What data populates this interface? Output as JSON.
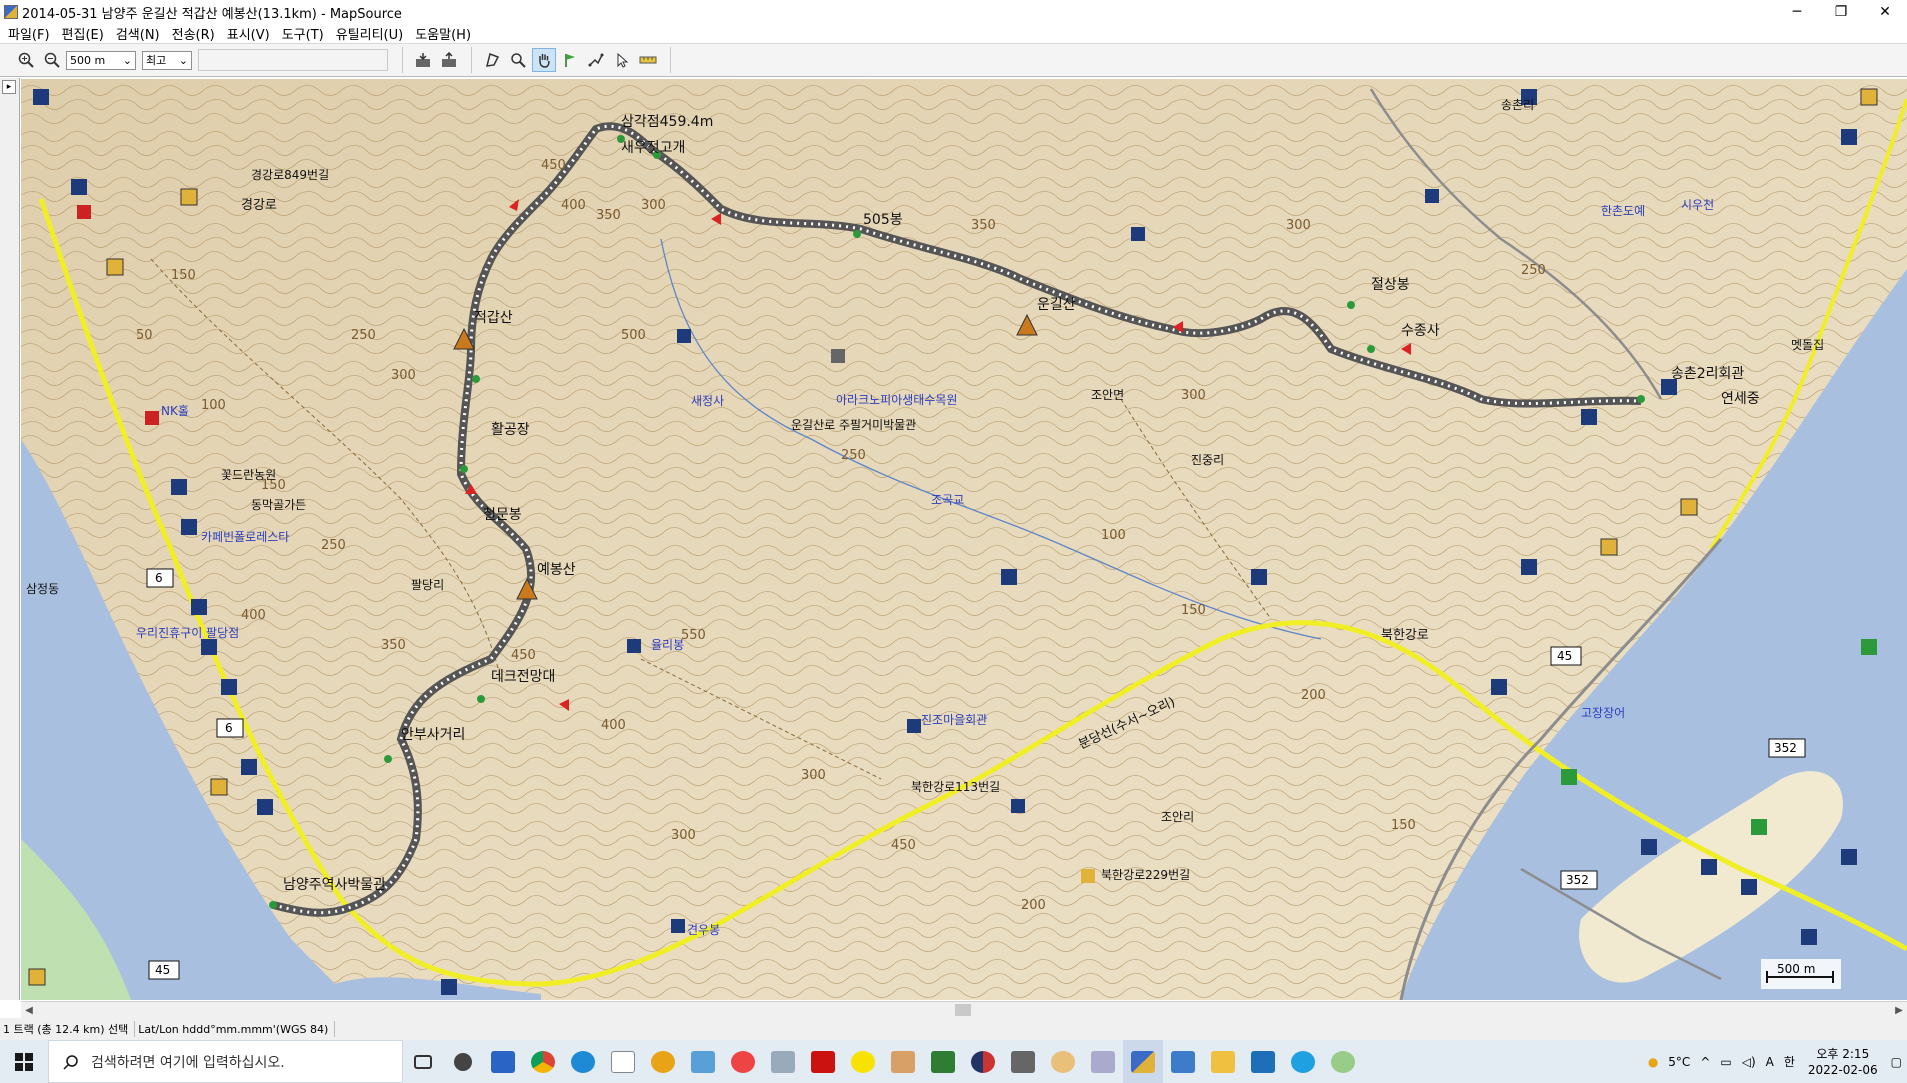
{
  "window": {
    "title": "2014-05-31 남양주 운길산 적갑산 예봉산(13.1km) - MapSource",
    "minimize": "─",
    "restore": "❐",
    "close": "✕"
  },
  "menu": [
    "파일(F)",
    "편집(E)",
    "검색(N)",
    "전송(R)",
    "표시(V)",
    "도구(T)",
    "유틸리티(U)",
    "도움말(H)"
  ],
  "toolbar": {
    "zoom_value": "500 m",
    "detail_value": "최고"
  },
  "map": {
    "colors": {
      "terrain": "#e9dcc0",
      "contour": "#b89a6a",
      "water": "#a9bfe0",
      "road_yellow": "#f0ee25",
      "track": "#6e6e6e",
      "label_blue": "#2b3ec0"
    },
    "peaks": [
      {
        "name": "적갑산"
      },
      {
        "name": "예봉산"
      },
      {
        "name": "운길산"
      }
    ],
    "waypoints": [
      {
        "name": "삼각점459.4m"
      },
      {
        "name": "새우젓고개"
      },
      {
        "name": "505봉"
      },
      {
        "name": "절상봉"
      },
      {
        "name": "수종사"
      },
      {
        "name": "송촌2리회관"
      },
      {
        "name": "활공장"
      },
      {
        "name": "철문봉"
      },
      {
        "name": "데크전망대"
      },
      {
        "name": "안부사거리"
      },
      {
        "name": "남양주역사박물관"
      },
      {
        "name": "연세중"
      }
    ],
    "places": [
      {
        "name": "경강로849번길"
      },
      {
        "name": "꽃드란농원"
      },
      {
        "name": "동막골가든"
      },
      {
        "name": "카페빈폴로레스타"
      },
      {
        "name": "NK홀"
      },
      {
        "name": "팔당리"
      },
      {
        "name": "새정사"
      },
      {
        "name": "율리봉"
      },
      {
        "name": "운길산로 주필거미박물관"
      },
      {
        "name": "아라크노피아생태수목원"
      },
      {
        "name": "조안면"
      },
      {
        "name": "진중리"
      },
      {
        "name": "조곡교"
      },
      {
        "name": "진조마을회관"
      },
      {
        "name": "북한강로113번길"
      },
      {
        "name": "조안리"
      },
      {
        "name": "북한강로229번길"
      },
      {
        "name": "견우봉"
      },
      {
        "name": "삼정동"
      },
      {
        "name": "우리진휴구이 팔당점"
      },
      {
        "name": "송촌리"
      },
      {
        "name": "시우천"
      },
      {
        "name": "한촌도예"
      },
      {
        "name": "고장장어"
      },
      {
        "name": "멧돌집"
      }
    ],
    "roads": [
      {
        "name": "분당선(수서~오리)"
      },
      {
        "name": "북한강로"
      },
      {
        "name": "경강로"
      }
    ],
    "route_shields": [
      "6",
      "6",
      "45",
      "45",
      "352",
      "352"
    ],
    "scale_label": "500 m"
  },
  "statusbar": {
    "selection": "1 트랙 (총 12.4 km) 선택",
    "coords_format": "Lat/Lon hddd°mm.mmm'(WGS 84)"
  },
  "taskbar": {
    "search_placeholder": "검색하려면 여기에 입력하십시오.",
    "weather": "5°C",
    "time": "오후 2:15",
    "date": "2022-02-06",
    "ime_a": "A",
    "ime_han": "한"
  }
}
